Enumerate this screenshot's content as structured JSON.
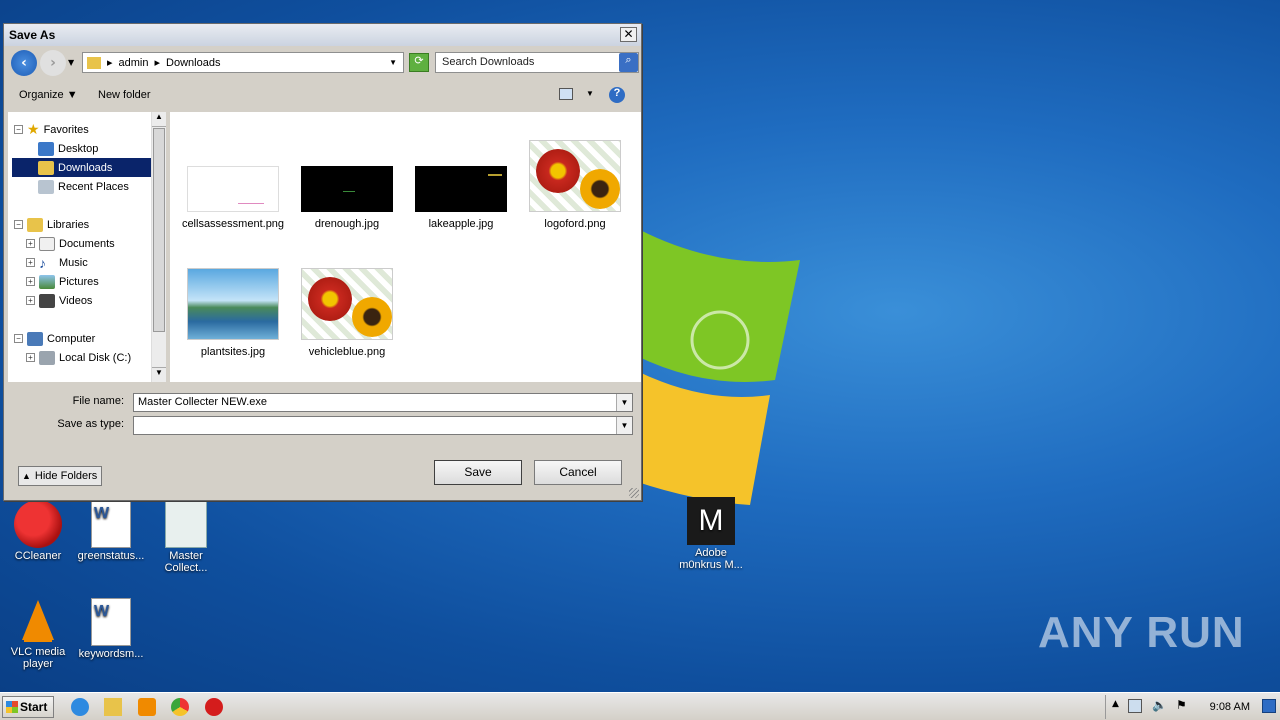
{
  "dialog": {
    "title": "Save As",
    "close_glyph": "✕",
    "address": [
      "admin",
      "Downloads"
    ],
    "search_placeholder": "Search Downloads",
    "toolbar": {
      "organize": "Organize",
      "new_folder": "New folder"
    },
    "tree": [
      {
        "label": "Favorites",
        "icon": "star-icon",
        "level": 0,
        "expander": "−"
      },
      {
        "label": "Desktop",
        "icon": "desktop-icon",
        "level": 1
      },
      {
        "label": "Downloads",
        "icon": "downloads-icon",
        "level": 1,
        "selected": true
      },
      {
        "label": "Recent Places",
        "icon": "recent-icon",
        "level": 1
      },
      {
        "label": "Libraries",
        "icon": "libraries-icon",
        "level": 0,
        "expander": "−"
      },
      {
        "label": "Documents",
        "icon": "documents-icon",
        "level": 1,
        "expander": "+"
      },
      {
        "label": "Music",
        "icon": "music-icon",
        "level": 1,
        "expander": "+"
      },
      {
        "label": "Pictures",
        "icon": "pictures-icon",
        "level": 1,
        "expander": "+"
      },
      {
        "label": "Videos",
        "icon": "videos-icon",
        "level": 1,
        "expander": "+"
      },
      {
        "label": "Computer",
        "icon": "computer-icon",
        "level": 0,
        "expander": "−"
      },
      {
        "label": "Local Disk (C:)",
        "icon": "disk-icon",
        "level": 1,
        "expander": "+"
      }
    ],
    "files": [
      {
        "name": "cellsassessment.png",
        "thumb": "white-thumb"
      },
      {
        "name": "drenough.jpg",
        "thumb": "black-thumb"
      },
      {
        "name": "lakeapple.jpg",
        "thumb": "black-thumb"
      },
      {
        "name": "logoford.png",
        "thumb": "flower-thumb"
      },
      {
        "name": "plantsites.jpg",
        "thumb": "landscape-thumb"
      },
      {
        "name": "vehicleblue.png",
        "thumb": "flower-thumb"
      }
    ],
    "file_name_label": "File name:",
    "file_name_value": "Master Collecter NEW.exe",
    "save_type_label": "Save as type:",
    "save_type_value": "",
    "save_label": "Save",
    "cancel_label": "Cancel",
    "hide_folders_label": "Hide Folders"
  },
  "desktop_icons": [
    {
      "label": "CCleaner"
    },
    {
      "label": "greenstatus..."
    },
    {
      "label": "Master Collect..."
    },
    {
      "label": "Adobe m0nkrus M..."
    },
    {
      "label": "VLC media player"
    },
    {
      "label": "keywordsm..."
    }
  ],
  "watermark": "ANY RUN",
  "taskbar": {
    "start_label": "Start",
    "clock": "9:08 AM"
  },
  "colors": {
    "selection": "#0a246a",
    "desktop": "#1f6cc0",
    "dialog": "#d4d0c8"
  }
}
